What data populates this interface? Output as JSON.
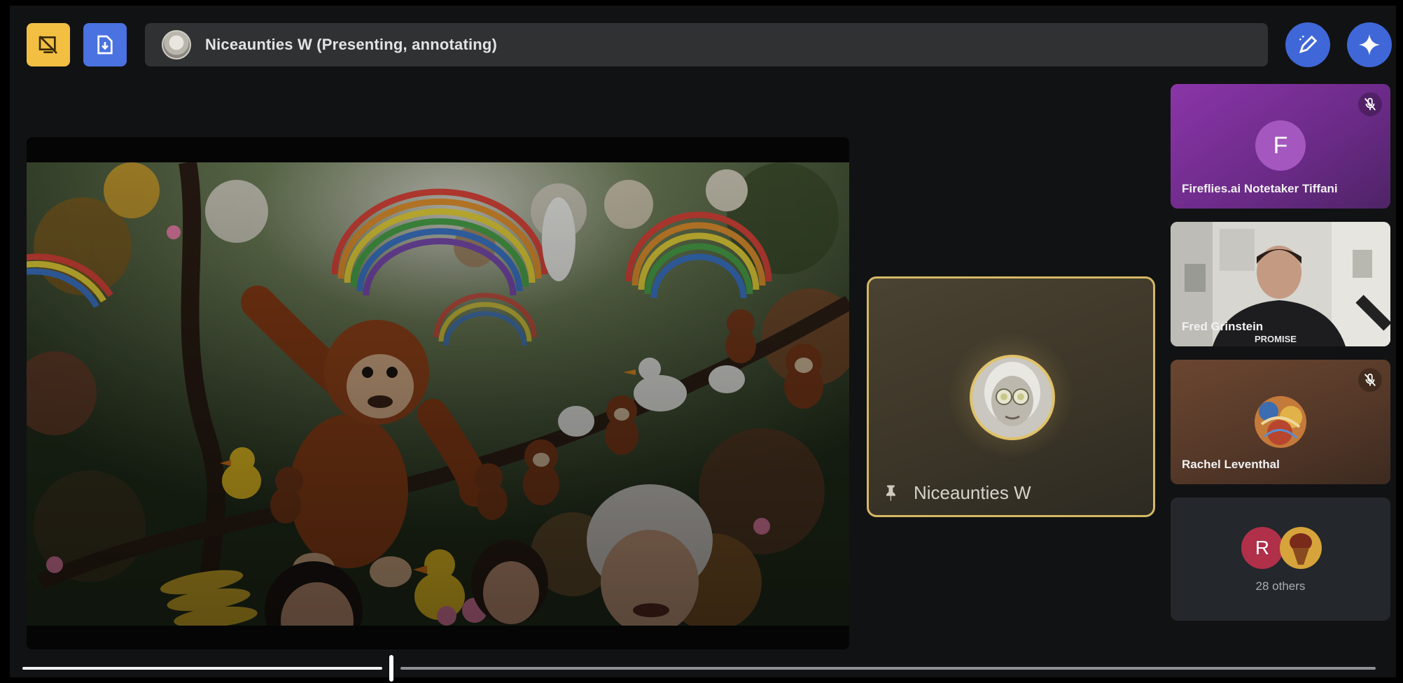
{
  "window": {
    "presenter_title": "Niceaunties W (Presenting, annotating)"
  },
  "toolbar": {
    "left_buttons": [
      {
        "icon": "screenshare-off-icon",
        "color": "#f2bf42"
      },
      {
        "icon": "document-download-icon",
        "color": "#4a72e0"
      }
    ],
    "right_buttons": [
      {
        "icon": "annotate-pen-icon",
        "color": "#3f67d8"
      },
      {
        "icon": "sparkle-icon",
        "color": "#3f67d8"
      }
    ]
  },
  "presenter_tile": {
    "name": "Niceaunties W",
    "icon": "pin-icon"
  },
  "participants": [
    {
      "name": "Fireflies.ai Notetaker Tiffani",
      "initial": "F",
      "muted": true,
      "color": "#7a2f96"
    },
    {
      "name": "Fred Grinstein",
      "muted": false,
      "shirt_text": "PROMISE"
    },
    {
      "name": "Rachel Leventhal",
      "muted": true
    }
  ],
  "others": {
    "label": "28 others",
    "initial": "R",
    "initial_color": "#b0304a"
  },
  "playback": {
    "progress": 0.27
  }
}
